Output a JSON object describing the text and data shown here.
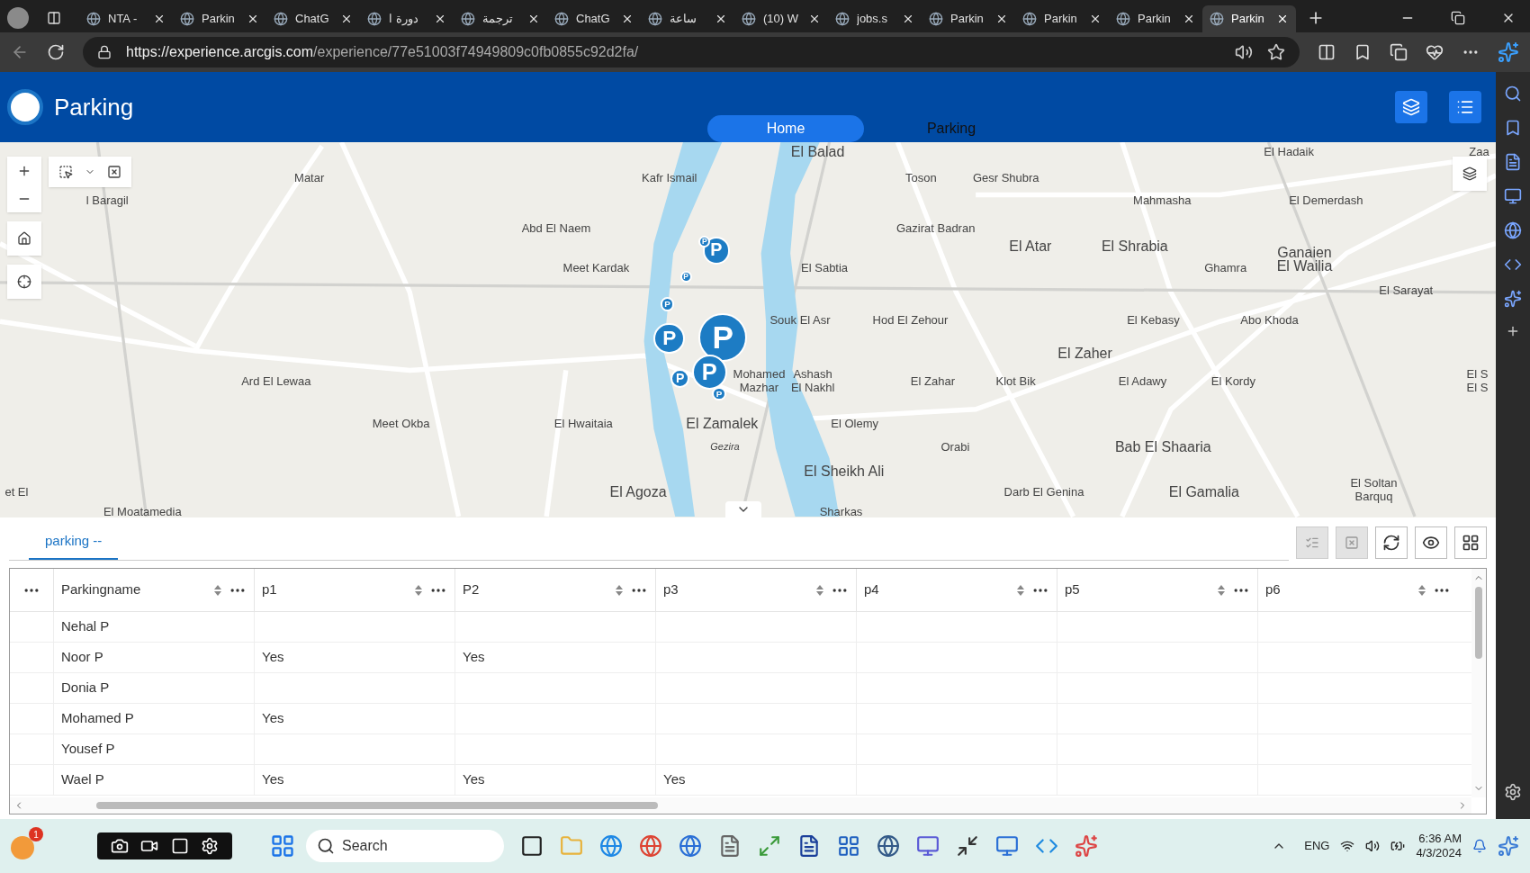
{
  "browser": {
    "tabs": [
      {
        "title": "NTA -",
        "selected": false
      },
      {
        "title": "Parkin",
        "selected": false
      },
      {
        "title": "ChatG",
        "selected": false
      },
      {
        "title": "دورة ا",
        "selected": false
      },
      {
        "title": "ترجمة",
        "selected": false
      },
      {
        "title": "ChatG",
        "selected": false
      },
      {
        "title": "ساعة",
        "selected": false
      },
      {
        "title": "(10) W",
        "selected": false
      },
      {
        "title": "jobs.s",
        "selected": false
      },
      {
        "title": "Parkin",
        "selected": false
      },
      {
        "title": "Parkin",
        "selected": false
      },
      {
        "title": "Parkin",
        "selected": false
      },
      {
        "title": "Parkin",
        "selected": true
      }
    ],
    "url_host": "https://experience.arcgis.com",
    "url_path": "/experience/77e51003f74949809c0fb0855c92d2fa/"
  },
  "header": {
    "title": "Parking",
    "nav": [
      {
        "label": "Home",
        "selected": true
      },
      {
        "label": "Parking",
        "selected": false
      }
    ]
  },
  "map": {
    "labels": [
      "El Balad",
      "El Hadaik",
      "Zaa",
      "Matar",
      "Kafr Ismail",
      "Toson",
      "Gesr Shubra",
      "l Baragil",
      "Mahmasha",
      "El Demerdash",
      "Abd El Naem",
      "Gazirat Badran",
      "El Atar",
      "El Shrabia",
      "Meet Kardak",
      "El Sabtia",
      "Ghamra",
      "Ganaien El Wailia",
      "El Sarayat",
      "Souk El Asr",
      "Hod El Zehour",
      "El Kebasy",
      "Abo Khoda",
      "El Zaher",
      "Ard El Lewaa",
      "Mohamed Mazhar",
      "Ashash El Nakhl",
      "El Zahar",
      "Klot Bik",
      "El Adawy",
      "El Kordy",
      "El S El S",
      "Meet Okba",
      "El Hwaitaia",
      "El Zamalek",
      "El Olemy",
      "Gezira",
      "Orabi",
      "Bab El Shaaria",
      "El Sheikh Ali",
      "et El",
      "El Agoza",
      "Darb El Genina",
      "El Gamalia",
      "El Soltan Barquq",
      "El Moatamedia",
      "Sharkas"
    ],
    "pins": [
      {
        "label": "P"
      },
      {
        "label": "P"
      },
      {
        "label": "P"
      },
      {
        "label": "P"
      },
      {
        "label": "P"
      },
      {
        "label": "P"
      },
      {
        "label": "P"
      },
      {
        "label": "P"
      },
      {
        "label": "P"
      }
    ]
  },
  "table": {
    "tab": "parking --",
    "columns": [
      "Parkingname",
      "p1",
      "P2",
      "p3",
      "p4",
      "p5",
      "p6"
    ],
    "rows": [
      [
        "Nehal P",
        "",
        "",
        "",
        "",
        "",
        ""
      ],
      [
        "Noor P",
        "Yes",
        "Yes",
        "",
        "",
        "",
        ""
      ],
      [
        "Donia P",
        "",
        "",
        "",
        "",
        "",
        ""
      ],
      [
        "Mohamed P",
        "Yes",
        "",
        "",
        "",
        "",
        ""
      ],
      [
        "Yousef P",
        "",
        "",
        "",
        "",
        "",
        ""
      ],
      [
        "Wael P",
        "Yes",
        "Yes",
        "Yes",
        "",
        "",
        ""
      ]
    ]
  },
  "taskbar": {
    "weather_badge": "1",
    "search": "Search",
    "language": "ENG",
    "time": "6:36 AM",
    "date": "4/3/2024"
  }
}
